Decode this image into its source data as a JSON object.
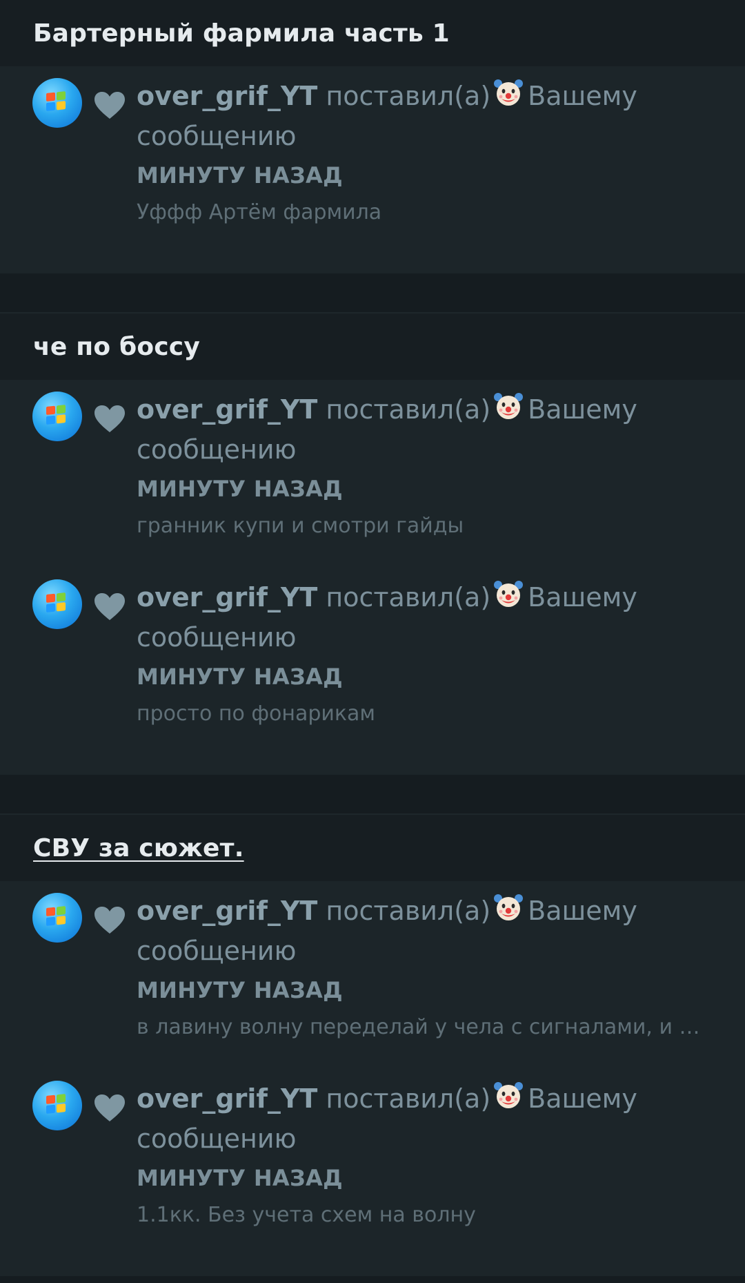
{
  "colors": {
    "background": "#151c20",
    "header_bg": "#171e22",
    "card_bg": "#1c2529",
    "header_text": "#e6ebee",
    "username": "#8aa0ab",
    "action_text": "#7d919c",
    "time_text": "#7b8f99",
    "snippet_text": "#5f6f77",
    "heart": "#7f97a2"
  },
  "groups": [
    {
      "title": "Бартерный фармила часть 1",
      "notifications": [
        {
          "username": "over_grif_YT",
          "action": "поставил(а)",
          "reaction_icon": "clown-face-icon",
          "target": "Вашему сообщению",
          "time": "МИНУТУ НАЗАД",
          "snippet": "Уффф Артём фармила"
        }
      ]
    },
    {
      "title": "че по боссу",
      "notifications": [
        {
          "username": "over_grif_YT",
          "action": "поставил(а)",
          "reaction_icon": "clown-face-icon",
          "target": "Вашему сообщению",
          "time": "МИНУТУ НАЗАД",
          "snippet": "гранник купи и смотри гайды"
        },
        {
          "username": "over_grif_YT",
          "action": "поставил(а)",
          "reaction_icon": "clown-face-icon",
          "target": "Вашему сообщению",
          "time": "МИНУТУ НАЗАД",
          "snippet": "просто по фонарикам"
        }
      ]
    },
    {
      "title": "СВУ за сюжет.",
      "notifications": [
        {
          "username": "over_grif_YT",
          "action": "поставил(а)",
          "reaction_icon": "clown-face-icon",
          "target": "Вашему сообщению",
          "time": "МИНУТУ НАЗАД",
          "snippet": "в лавину волну переделай у чела с сигналами, и п…"
        },
        {
          "username": "over_grif_YT",
          "action": "поставил(а)",
          "reaction_icon": "clown-face-icon",
          "target": "Вашему сообщению",
          "time": "МИНУТУ НАЗАД",
          "snippet": "1.1кк. Без учета схем на волну"
        }
      ]
    }
  ]
}
